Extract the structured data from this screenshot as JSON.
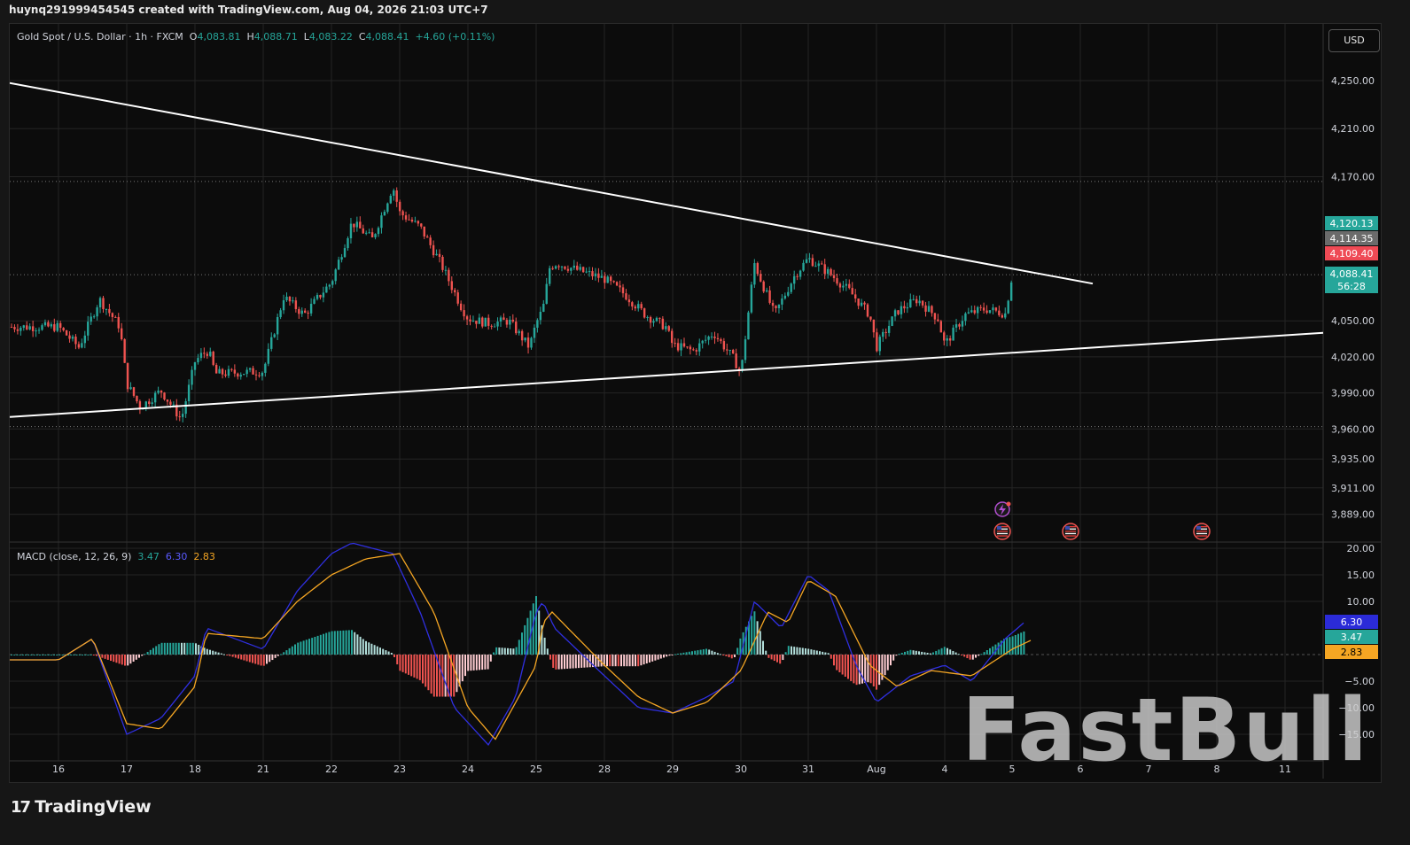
{
  "header": {
    "created_by": "huynq291999454545 created with TradingView.com, Aug 04, 2026 21:03 UTC+7"
  },
  "legend": {
    "symbol": "Gold Spot / U.S. Dollar · 1h · FXCM",
    "open_label": "O",
    "open": "4,083.81",
    "high_label": "H",
    "high": "4,088.71",
    "low_label": "L",
    "low": "4,083.22",
    "close_label": "C",
    "close": "4,088.41",
    "change": "+4.60 (+0.11%)"
  },
  "currency_button": "USD",
  "macd_legend": {
    "title": "MACD (close, 12, 26, 9)",
    "histogram": "3.47",
    "macd": "6.30",
    "signal": "2.83"
  },
  "price_axis": {
    "ticks": [
      "4,250.00",
      "4,210.00",
      "4,170.00",
      "4,050.00",
      "4,020.00",
      "3,990.00",
      "3,960.00",
      "3,935.00",
      "3,911.00",
      "3,889.00"
    ],
    "badges": [
      {
        "label": "4,120.13",
        "color": "#26a69a"
      },
      {
        "label": "4,114.35",
        "color": "#6b6b6b"
      },
      {
        "label": "4,109.40",
        "color": "#ef4a55"
      },
      {
        "label": "4,088.41",
        "sub": "56:28",
        "color": "#26a69a"
      }
    ]
  },
  "macd_axis": {
    "ticks": [
      "20.00",
      "15.00",
      "10.00",
      "−5.00",
      "−10.00",
      "−15.00"
    ],
    "badges": [
      {
        "label": "6.30",
        "color": "#2b2bd8",
        "text_color": "#ffffff"
      },
      {
        "label": "3.47",
        "color": "#26a69a",
        "text_color": "#ffffff"
      },
      {
        "label": "2.83",
        "color": "#f5a623",
        "text_color": "#000000"
      }
    ]
  },
  "time_axis": [
    "16",
    "17",
    "18",
    "21",
    "22",
    "23",
    "24",
    "25",
    "28",
    "29",
    "30",
    "31",
    "Aug",
    "4",
    "5",
    "6",
    "7",
    "8",
    "11"
  ],
  "colors": {
    "up": "#26a69a",
    "down": "#ef5350",
    "macd_line": "#2f2fe0",
    "signal_line": "#f5a623",
    "trendline": "#ffffff"
  },
  "icons": [
    "lightning-event-icon",
    "us-flag-event-icon",
    "us-flag-event-icon",
    "us-flag-event-icon"
  ],
  "footer": {
    "brand": "TradingView",
    "logo": "17"
  },
  "watermark": "FastBull",
  "chart_data": {
    "type": "candlestick",
    "title": "Gold Spot / U.S. Dollar · 1h · FXCM",
    "ylim": [
      3880,
      4272
    ],
    "x_labels": [
      "16",
      "17",
      "18",
      "21",
      "22",
      "23",
      "24",
      "25",
      "28",
      "29",
      "30",
      "31",
      "Aug",
      "4",
      "5",
      "6",
      "7",
      "8",
      "11"
    ],
    "price_path": [
      [
        16,
        4045
      ],
      [
        16.3,
        4028
      ],
      [
        16.6,
        4068
      ],
      [
        16.9,
        4045
      ],
      [
        17.0,
        3998
      ],
      [
        17.2,
        3978
      ],
      [
        17.5,
        3992
      ],
      [
        17.8,
        3968
      ],
      [
        18.0,
        4016
      ],
      [
        18.3,
        4022
      ],
      [
        18.6,
        4025
      ],
      [
        18.9,
        4006
      ],
      [
        21.0,
        4008
      ],
      [
        21.3,
        4070
      ],
      [
        21.6,
        4055
      ],
      [
        21.9,
        4076
      ],
      [
        22.0,
        4082
      ],
      [
        22.3,
        4132
      ],
      [
        22.6,
        4118
      ],
      [
        22.9,
        4162
      ],
      [
        23.0,
        4140
      ],
      [
        23.3,
        4128
      ],
      [
        23.6,
        4098
      ],
      [
        23.9,
        4062
      ],
      [
        24.0,
        4052
      ],
      [
        24.3,
        4048
      ],
      [
        24.6,
        4050
      ],
      [
        24.9,
        4028
      ],
      [
        25.0,
        4048
      ],
      [
        25.3,
        4060
      ],
      [
        25.6,
        4095
      ],
      [
        25.9,
        4098
      ],
      [
        28.0,
        4085
      ],
      [
        28.3,
        4072
      ],
      [
        28.6,
        4055
      ],
      [
        28.9,
        4045
      ],
      [
        29.0,
        4030
      ],
      [
        29.3,
        4025
      ],
      [
        29.6,
        4040
      ],
      [
        29.9,
        4018
      ],
      [
        30.0,
        4006
      ],
      [
        30.2,
        4098
      ],
      [
        30.5,
        4055
      ],
      [
        30.8,
        4088
      ],
      [
        31.0,
        4102
      ],
      [
        31.3,
        4090
      ],
      [
        31.6,
        4075
      ],
      [
        31.9,
        4055
      ],
      [
        32.0,
        4028
      ],
      [
        32.3,
        4058
      ],
      [
        32.6,
        4068
      ],
      [
        32.9,
        4052
      ],
      [
        33.0,
        4030
      ],
      [
        33.3,
        4055
      ],
      [
        33.6,
        4060
      ],
      [
        33.9,
        4056
      ],
      [
        34.0,
        4088
      ]
    ],
    "last_price": 4088.41,
    "trendlines": [
      {
        "name": "descending resistance",
        "from": [
          "15.3",
          4248
        ],
        "to": [
          "5",
          4081
        ]
      },
      {
        "name": "ascending support",
        "from": [
          "15.3",
          3970
        ],
        "to": [
          "11",
          4040
        ]
      }
    ],
    "macd": {
      "params": "close, 12, 26, 9",
      "ylim": [
        -20,
        22
      ],
      "macd_line": [
        [
          16,
          -1
        ],
        [
          16.5,
          3
        ],
        [
          17,
          -15
        ],
        [
          17.5,
          -12
        ],
        [
          18,
          -4
        ],
        [
          18.5,
          5
        ],
        [
          21,
          1
        ],
        [
          21.5,
          12
        ],
        [
          22,
          19
        ],
        [
          22.3,
          21
        ],
        [
          22.9,
          19
        ],
        [
          23.3,
          8
        ],
        [
          23.8,
          -10
        ],
        [
          24.3,
          -17
        ],
        [
          24.7,
          -8
        ],
        [
          25,
          8
        ],
        [
          25.3,
          10
        ],
        [
          25.8,
          5
        ],
        [
          28,
          -4
        ],
        [
          28.5,
          -10
        ],
        [
          29,
          -11
        ],
        [
          29.5,
          -8
        ],
        [
          29.9,
          -5
        ],
        [
          30.2,
          10
        ],
        [
          30.6,
          5
        ],
        [
          31,
          15
        ],
        [
          31.3,
          12
        ],
        [
          31.7,
          -2
        ],
        [
          32,
          -9
        ],
        [
          32.5,
          -4
        ],
        [
          33,
          -2
        ],
        [
          33.4,
          -5
        ],
        [
          33.9,
          3
        ],
        [
          34.2,
          6.3
        ]
      ],
      "signal_line": [
        [
          16,
          -1
        ],
        [
          16.5,
          3
        ],
        [
          17,
          -13
        ],
        [
          17.5,
          -14
        ],
        [
          18,
          -6
        ],
        [
          18.5,
          4
        ],
        [
          21,
          3
        ],
        [
          21.5,
          10
        ],
        [
          22,
          15
        ],
        [
          22.5,
          18
        ],
        [
          23,
          19
        ],
        [
          23.5,
          8
        ],
        [
          24,
          -10
        ],
        [
          24.4,
          -16
        ],
        [
          25,
          -2
        ],
        [
          25.3,
          6
        ],
        [
          25.7,
          8
        ],
        [
          28,
          -2
        ],
        [
          28.5,
          -8
        ],
        [
          29,
          -11
        ],
        [
          29.5,
          -9
        ],
        [
          30,
          -3
        ],
        [
          30.4,
          8
        ],
        [
          30.7,
          6
        ],
        [
          31,
          14
        ],
        [
          31.4,
          11
        ],
        [
          31.9,
          -2
        ],
        [
          32.3,
          -6
        ],
        [
          32.8,
          -3
        ],
        [
          33.4,
          -4
        ],
        [
          34,
          1
        ],
        [
          34.3,
          2.83
        ]
      ],
      "last_histogram": 3.47,
      "last_macd": 6.3,
      "last_signal": 2.83
    }
  }
}
